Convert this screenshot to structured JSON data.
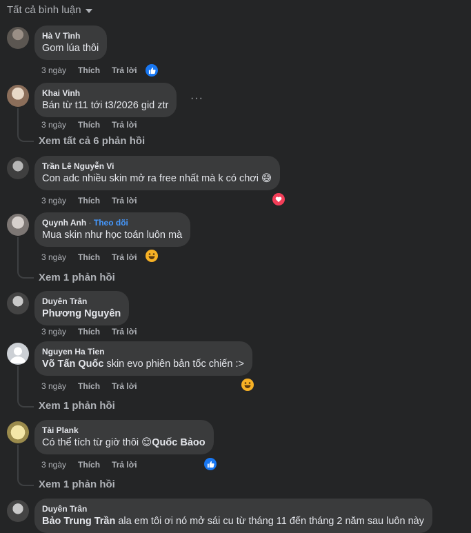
{
  "filter": {
    "label": "Tất cả bình luận"
  },
  "comments": [
    {
      "name": "Hà V Tình",
      "text": "Gom lúa thôi",
      "time": "3 ngày",
      "like": "Thích",
      "reply": "Trả lời",
      "reaction": "like"
    },
    {
      "name": "Khai Vinh",
      "text": "Bán từ t11 tới t3/2026 gid ztr",
      "time": "3 ngày",
      "like": "Thích",
      "reply": "Trả lời",
      "replies": "Xem tất cả 6 phản hồi"
    },
    {
      "name": "Trần Lê Nguyễn Vi",
      "text": "Con adc nhiều skin mở ra free nhất mà k có chơi",
      "time": "3 ngày",
      "like": "Thích",
      "reply": "Trả lời",
      "reaction": "love"
    },
    {
      "name": "Quynh Anh",
      "follow": "Theo dõi",
      "text": "Mua skin như học toán luôn mà",
      "time": "3 ngày",
      "like": "Thích",
      "reply": "Trả lời",
      "reaction": "haha",
      "replies": "Xem 1 phản hồi"
    },
    {
      "name": "Duyên Trân",
      "mention": "Phương Nguyên",
      "time": "3 ngày",
      "like": "Thích",
      "reply": "Trả lời"
    },
    {
      "name": "Nguyen Ha Tien",
      "mention": "Võ Tấn Quốc",
      "text": " skin evo phiên bản tốc chiến :>",
      "time": "3 ngày",
      "like": "Thích",
      "reply": "Trả lời",
      "reaction": "haha",
      "replies": "Xem 1 phản hồi"
    },
    {
      "name": "Tài Plank",
      "text": "Có thể tích từ giờ thôi ",
      "mention": "Quốc Bảoo",
      "time": "3 ngày",
      "like": "Thích",
      "reply": "Trả lời",
      "reaction": "like",
      "replies": "Xem 1 phản hồi"
    },
    {
      "name": "Duyên Trân",
      "mention": "Bảo Trung Trần",
      "text": " ala em tôi ơi nó mở sái cu từ tháng 11 đến tháng 2 năm sau luôn này"
    }
  ]
}
